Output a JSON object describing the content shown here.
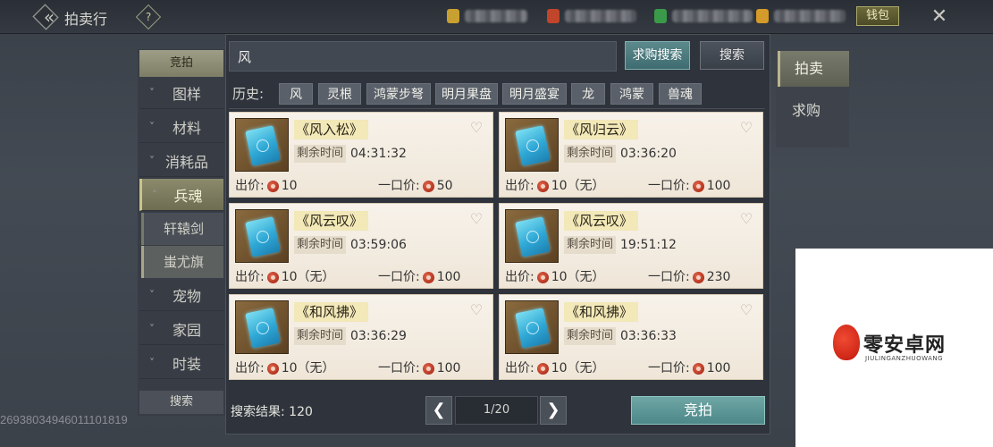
{
  "header": {
    "title": "拍卖行",
    "help_label": "?",
    "wallet_label": "钱包",
    "back_glyph": "«",
    "close_glyph": "✕",
    "currencies": [
      {
        "icon": "gold-ingot-icon",
        "color": "#c8a030"
      },
      {
        "icon": "red-gem-icon",
        "color": "#c0452a"
      },
      {
        "icon": "green-jade-icon",
        "color": "#3a9a4a"
      },
      {
        "icon": "gold-coin-icon",
        "color": "#d49a2a"
      }
    ]
  },
  "sidebar": {
    "top_tab": "竞拍",
    "categories": [
      {
        "label": "图样",
        "expanded": false
      },
      {
        "label": "材料",
        "expanded": false
      },
      {
        "label": "消耗品",
        "expanded": false
      },
      {
        "label": "兵魂",
        "expanded": true
      },
      {
        "label": "宠物",
        "expanded": false
      },
      {
        "label": "家园",
        "expanded": false
      },
      {
        "label": "时装",
        "expanded": false
      }
    ],
    "subitems": [
      "轩辕剑",
      "蚩尤旗"
    ],
    "search_label": "搜索",
    "player_id": "26938034946011101819"
  },
  "search": {
    "query": "风",
    "want_search_label": "求购搜索",
    "search_label": "搜索"
  },
  "history": {
    "label": "历史:",
    "items": [
      "风",
      "灵根",
      "鸿蒙步弩",
      "明月果盘",
      "明月盛宴",
      "龙",
      "鸿蒙",
      "兽魂"
    ]
  },
  "items": [
    {
      "name": "《风入松》",
      "remaining_label": "剩余时间",
      "remaining": "04:31:32",
      "bid_label": "出价:",
      "bid": "10",
      "buyout_label": "一口价:",
      "buyout": "50"
    },
    {
      "name": "《风归云》",
      "remaining_label": "剩余时间",
      "remaining": "03:36:20",
      "bid_label": "出价:",
      "bid": "10（无）",
      "buyout_label": "一口价:",
      "buyout": "100"
    },
    {
      "name": "《风云叹》",
      "remaining_label": "剩余时间",
      "remaining": "03:59:06",
      "bid_label": "出价:",
      "bid": "10（无）",
      "buyout_label": "一口价:",
      "buyout": "100"
    },
    {
      "name": "《风云叹》",
      "remaining_label": "剩余时间",
      "remaining": "19:51:12",
      "bid_label": "出价:",
      "bid": "10（无）",
      "buyout_label": "一口价:",
      "buyout": "230"
    },
    {
      "name": "《和风拂》",
      "remaining_label": "剩余时间",
      "remaining": "03:36:29",
      "bid_label": "出价:",
      "bid": "10（无）",
      "buyout_label": "一口价:",
      "buyout": "100"
    },
    {
      "name": "《和风拂》",
      "remaining_label": "剩余时间",
      "remaining": "03:36:33",
      "bid_label": "出价:",
      "bid": "10（无）",
      "buyout_label": "一口价:",
      "buyout": "100"
    }
  ],
  "footer": {
    "result_label": "搜索结果:",
    "result_count": "120",
    "page": "1/20",
    "bid_button": "竞拍"
  },
  "right_tabs": [
    {
      "label": "拍卖",
      "active": true
    },
    {
      "label": "求购",
      "active": false
    }
  ],
  "watermark": {
    "text": "零安卓网",
    "sub": "JIULINGANZHUOWANG"
  },
  "colors": {
    "accent_teal": "#5c8a8c",
    "card_bg": "#f7f2ea",
    "active_tab": "#8b8a6c",
    "coin_red": "#b2321e"
  }
}
